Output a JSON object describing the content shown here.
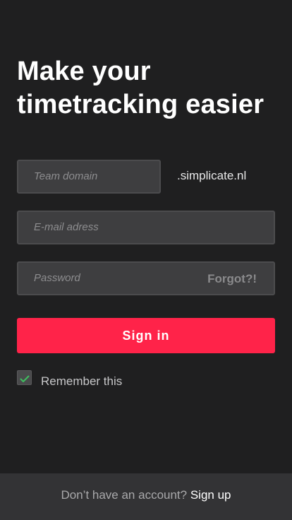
{
  "login": {
    "title": "Make your timetracking easier",
    "domain_placeholder": "Team domain",
    "domain_suffix": ".simplicate.nl",
    "email_placeholder": "E-mail adress",
    "password_placeholder": "Password",
    "forgot_label": "Forgot?!",
    "signin_label": "Sign in",
    "remember_label": "Remember this",
    "remember_checked": true,
    "check_icon": "checkmark-icon"
  },
  "footer": {
    "question": "Don’t have an account?",
    "signup_label": "Sign up"
  },
  "colors": {
    "background": "#1f1f20",
    "accent": "#ff2349",
    "check": "#3fbf5f",
    "footer": "#333335"
  }
}
